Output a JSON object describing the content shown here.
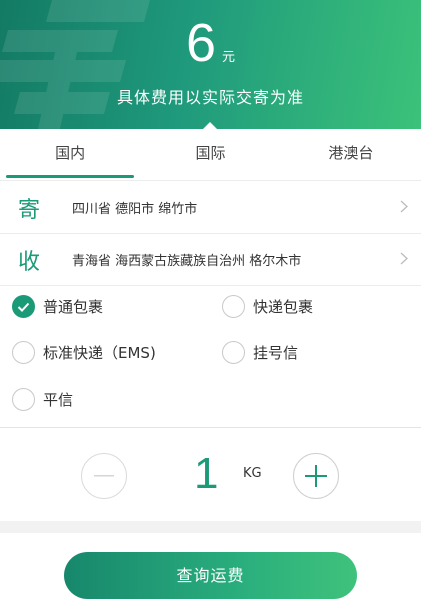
{
  "header": {
    "price_value": "6",
    "price_unit": "元",
    "price_note": "具体费用以实际交寄为准"
  },
  "tabs": [
    {
      "label": "国内",
      "active": true
    },
    {
      "label": "国际",
      "active": false
    },
    {
      "label": "港澳台",
      "active": false
    }
  ],
  "sender": {
    "tag": "寄",
    "address": "四川省 德阳市 绵竹市"
  },
  "receiver": {
    "tag": "收",
    "address": "青海省 海西蒙古族藏族自治州 格尔木市"
  },
  "options": [
    {
      "label": "普通包裹",
      "selected": true
    },
    {
      "label": "快递包裹",
      "selected": false
    },
    {
      "label": "标准快递（EMS)",
      "selected": false
    },
    {
      "label": "挂号信",
      "selected": false
    },
    {
      "label": "平信",
      "selected": false
    }
  ],
  "quantity": {
    "value": "1",
    "unit": "KG"
  },
  "submit_label": "查询运费",
  "colors": {
    "accent": "#1a9a76",
    "header_start": "#137a63",
    "header_end": "#3cc27a"
  }
}
